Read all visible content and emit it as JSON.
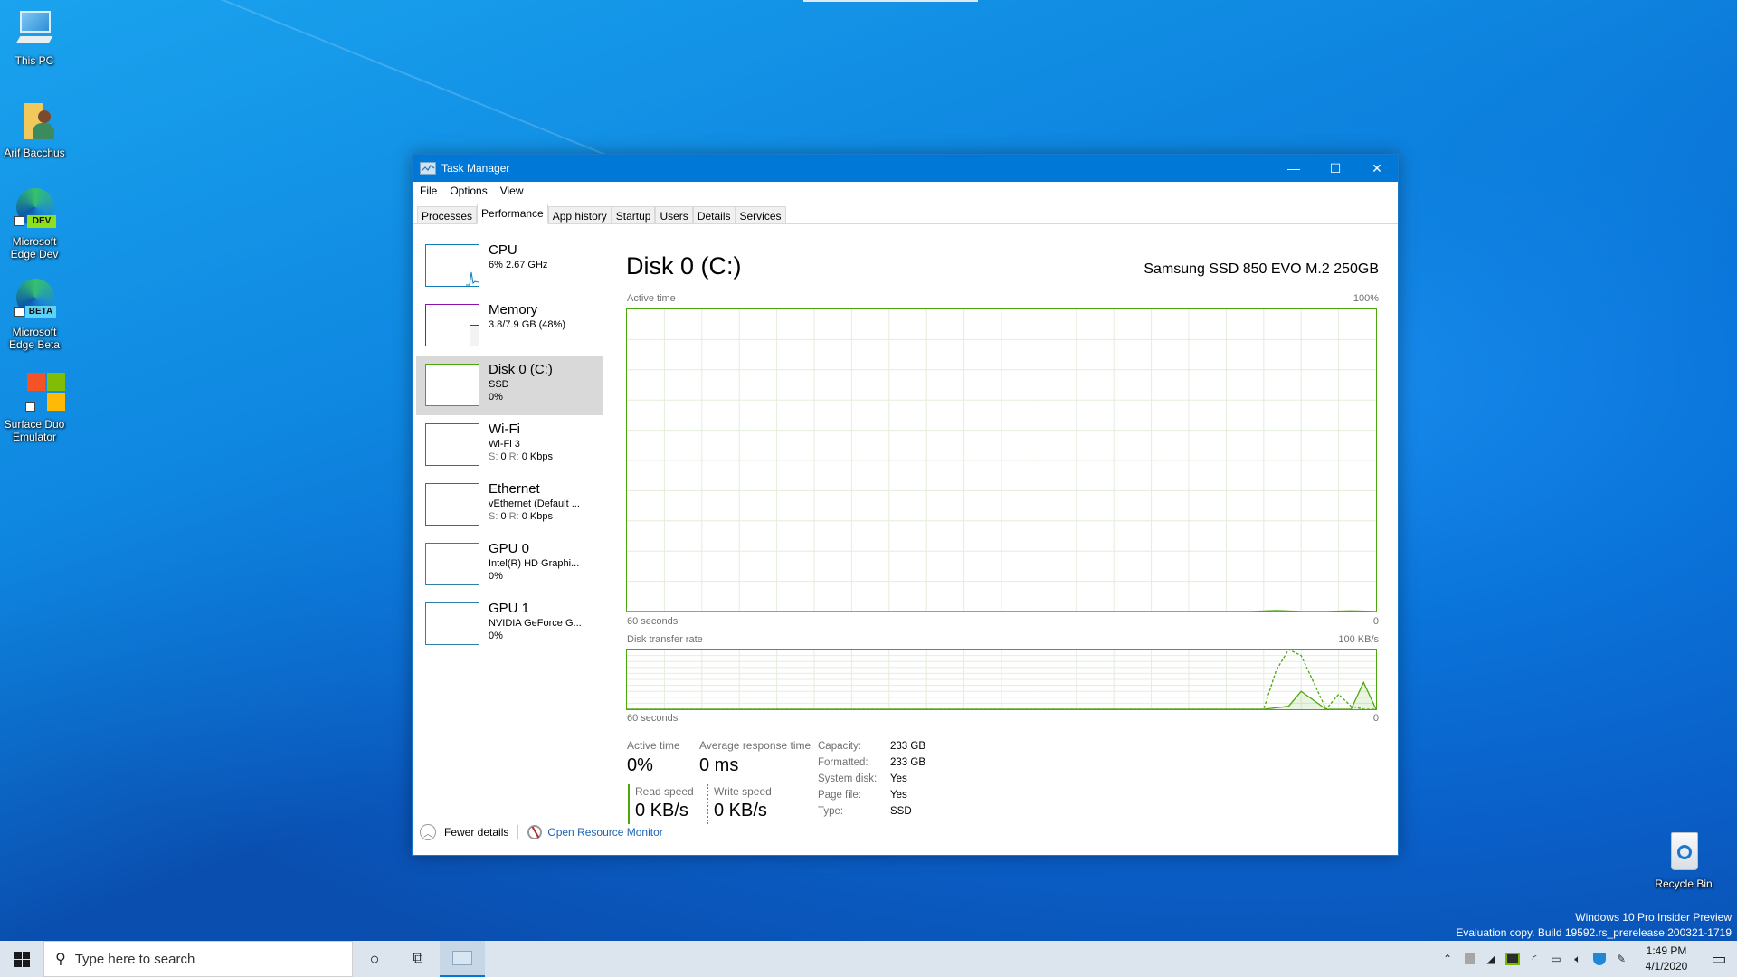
{
  "desktop": {
    "icons": [
      {
        "label": "This PC",
        "icon": "computer-icon"
      },
      {
        "label": "Arif Bacchus",
        "icon": "user-folder-icon"
      },
      {
        "label": "Microsoft Edge Dev",
        "icon": "edge-dev-icon",
        "badge": "DEV"
      },
      {
        "label": "Microsoft Edge Beta",
        "icon": "edge-beta-icon",
        "badge": "BETA"
      },
      {
        "label": "Surface Duo Emulator",
        "icon": "surface-duo-icon"
      },
      {
        "label": "Recycle Bin",
        "icon": "recycle-bin-icon"
      }
    ],
    "watermark": {
      "line1": "Windows 10 Pro Insider Preview",
      "line2": "Evaluation copy. Build 19592.rs_prerelease.200321-1719"
    }
  },
  "window": {
    "title": "Task Manager",
    "controls": {
      "minimize": "—",
      "maximize": "☐",
      "close": "✕"
    },
    "menu": [
      "File",
      "Options",
      "View"
    ],
    "tabs": [
      {
        "label": "Processes",
        "active": false
      },
      {
        "label": "Performance",
        "active": true
      },
      {
        "label": "App history",
        "active": false
      },
      {
        "label": "Startup",
        "active": false
      },
      {
        "label": "Users",
        "active": false
      },
      {
        "label": "Details",
        "active": false
      },
      {
        "label": "Services",
        "active": false
      }
    ],
    "sidebar": [
      {
        "name": "CPU",
        "line1": "6%  2.67 GHz",
        "line2": "",
        "color": "#117dbb",
        "selected": false
      },
      {
        "name": "Memory",
        "line1": "3.8/7.9 GB (48%)",
        "line2": "",
        "color": "#8b12ae",
        "selected": false
      },
      {
        "name": "Disk 0 (C:)",
        "line1": "SSD",
        "line2": "0%",
        "color": "#4da60c",
        "selected": true
      },
      {
        "name": "Wi-Fi",
        "line1": "Wi-Fi 3",
        "line2_s": "S:",
        "line2_sv": " 0 ",
        "line2_r": "R:",
        "line2_rv": " 0 Kbps",
        "color": "#a74f01",
        "selected": false
      },
      {
        "name": "Ethernet",
        "line1": "vEthernet (Default ...",
        "line2_s": "S:",
        "line2_sv": " 0 ",
        "line2_r": "R:",
        "line2_rv": " 0 Kbps",
        "color": "#a74f01",
        "selected": false
      },
      {
        "name": "GPU 0",
        "line1": "Intel(R) HD Graphi...",
        "line2": "0%",
        "color": "#2b7fa8",
        "selected": false
      },
      {
        "name": "GPU 1",
        "line1": "NVIDIA GeForce G...",
        "line2": "0%",
        "color": "#2b7fa8",
        "selected": false
      }
    ],
    "detail": {
      "title": "Disk 0 (C:)",
      "model": "Samsung SSD 850 EVO M.2 250GB",
      "graph1": {
        "label": "Active time",
        "max": "100%",
        "xlabel": "60 seconds",
        "min": "0"
      },
      "graph2": {
        "label": "Disk transfer rate",
        "max": "100 KB/s",
        "xlabel": "60 seconds",
        "min": "0"
      },
      "stats": {
        "active_time_label": "Active time",
        "active_time_value": "0%",
        "avg_resp_label": "Average response time",
        "avg_resp_value": "0 ms",
        "read_label": "Read speed",
        "read_value": "0 KB/s",
        "write_label": "Write speed",
        "write_value": "0 KB/s"
      },
      "properties": [
        {
          "key": "Capacity:",
          "value": "233 GB"
        },
        {
          "key": "Formatted:",
          "value": "233 GB"
        },
        {
          "key": "System disk:",
          "value": "Yes"
        },
        {
          "key": "Page file:",
          "value": "Yes"
        },
        {
          "key": "Type:",
          "value": "SSD"
        }
      ]
    },
    "footer": {
      "fewer_details": "Fewer details",
      "resource_monitor": "Open Resource Monitor"
    }
  },
  "chart_data": [
    {
      "type": "area",
      "title": "Active time",
      "xlabel": "60 seconds",
      "ylim": [
        0,
        100
      ],
      "unit": "%",
      "series": [
        {
          "name": "Active time",
          "x_seconds_ago": [
            60,
            10,
            8,
            6,
            4,
            2,
            0
          ],
          "values": [
            0,
            0,
            0.3,
            0,
            0,
            0.2,
            0
          ]
        }
      ]
    },
    {
      "type": "line",
      "title": "Disk transfer rate",
      "xlabel": "60 seconds",
      "ylim": [
        0,
        100
      ],
      "unit": "KB/s",
      "series": [
        {
          "name": "Read speed",
          "x_seconds_ago": [
            60,
            9,
            7,
            6,
            4,
            3,
            2,
            1,
            0
          ],
          "values": [
            0,
            0,
            5,
            30,
            0,
            0,
            0,
            45,
            0
          ],
          "style": "solid"
        },
        {
          "name": "Write speed",
          "x_seconds_ago": [
            60,
            9,
            8,
            7,
            6,
            4,
            3,
            2,
            1,
            0
          ],
          "values": [
            0,
            0,
            65,
            100,
            90,
            0,
            25,
            5,
            0,
            0
          ],
          "style": "dashed"
        }
      ]
    }
  ],
  "taskbar": {
    "search_placeholder": "Type here to search",
    "clock_time": "1:49 PM",
    "clock_date": "4/1/2020"
  }
}
